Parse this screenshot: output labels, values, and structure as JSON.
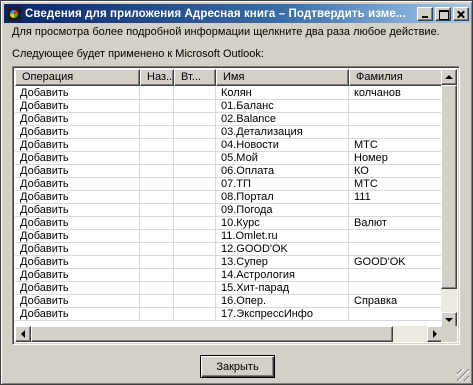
{
  "window": {
    "title": "Сведения для приложения Адресная книга – Подтвердить изме..."
  },
  "info_text": "Для просмотра более подробной информации щелкните два раза любое действие.",
  "list_caption": "Следующее будет применено к Microsoft Outlook:",
  "columns": [
    "Операция",
    "Наз...",
    "Вт...",
    "Имя",
    "Фамилия"
  ],
  "rows": [
    {
      "op": "Добавить",
      "name": "Колян",
      "surname": "колчанов"
    },
    {
      "op": "Добавить",
      "name": "01.Баланс",
      "surname": ""
    },
    {
      "op": "Добавить",
      "name": "02.Balance",
      "surname": ""
    },
    {
      "op": "Добавить",
      "name": "03.Детализация",
      "surname": ""
    },
    {
      "op": "Добавить",
      "name": "04.Новости",
      "surname": "МТС"
    },
    {
      "op": "Добавить",
      "name": "05.Мой",
      "surname": "Номер"
    },
    {
      "op": "Добавить",
      "name": "06.Оплата",
      "surname": "КО"
    },
    {
      "op": "Добавить",
      "name": "07.ТП",
      "surname": "МТС"
    },
    {
      "op": "Добавить",
      "name": "08.Портал",
      "surname": "111"
    },
    {
      "op": "Добавить",
      "name": "09.Погода",
      "surname": ""
    },
    {
      "op": "Добавить",
      "name": "10.Курс",
      "surname": "Валют"
    },
    {
      "op": "Добавить",
      "name": "11.Omlet.ru",
      "surname": ""
    },
    {
      "op": "Добавить",
      "name": "12.GOOD'OK",
      "surname": ""
    },
    {
      "op": "Добавить",
      "name": "13.Супер",
      "surname": "GOOD'OK"
    },
    {
      "op": "Добавить",
      "name": "14.Астрология",
      "surname": ""
    },
    {
      "op": "Добавить",
      "name": "15.Хит-парад",
      "surname": ""
    },
    {
      "op": "Добавить",
      "name": "16.Опер.",
      "surname": "Справка"
    },
    {
      "op": "Добавить",
      "name": "17.ЭкспрессИнфо",
      "surname": ""
    }
  ],
  "close_button": "Закрыть",
  "icons": [
    "app-icon",
    "minimize-icon",
    "maximize-icon",
    "close-icon",
    "scroll-up-icon",
    "scroll-down-icon",
    "scroll-left-icon",
    "scroll-right-icon",
    "size-grip-icon"
  ]
}
